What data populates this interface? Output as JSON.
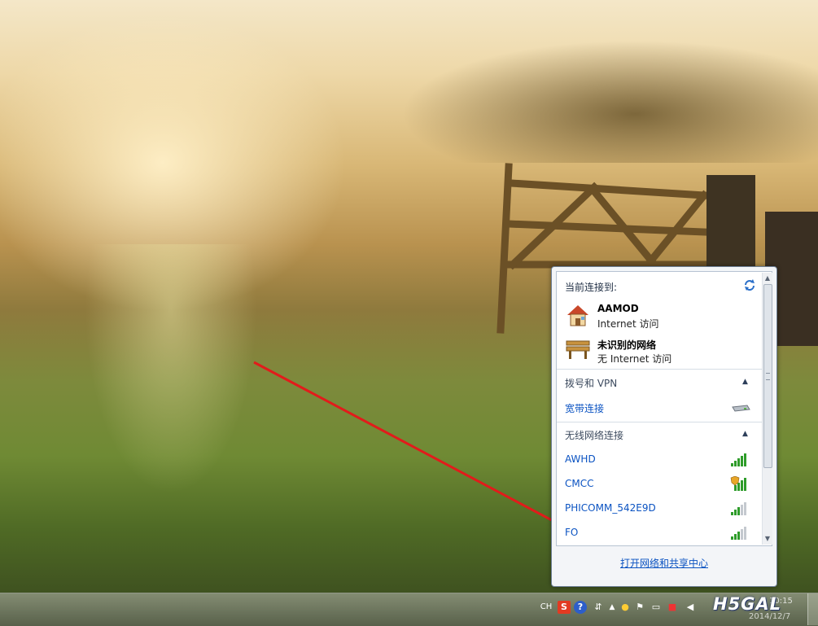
{
  "popup": {
    "header": "当前连接到:",
    "connections": [
      {
        "name": "AAMOD",
        "status": "Internet 访问",
        "icon": "home-network-icon"
      },
      {
        "name": "未识别的网络",
        "status": "无 Internet 访问",
        "icon": "public-network-bench-icon"
      }
    ],
    "dialup_section": {
      "label": "拨号和 VPN",
      "items": [
        {
          "name": "宽带连接",
          "icon": "modem-icon"
        }
      ]
    },
    "wireless_section": {
      "label": "无线网络连接",
      "networks": [
        {
          "ssid": "AWHD",
          "secured": false
        },
        {
          "ssid": "CMCC",
          "secured": true
        },
        {
          "ssid": "PHICOMM_542E9D",
          "secured": false
        },
        {
          "ssid": "FO",
          "secured": false
        }
      ]
    },
    "footer_link": "打开网络和共享中心"
  },
  "taskbar": {
    "language": "CH",
    "time": "10:15",
    "date": "2014/12/7"
  },
  "watermark": "H5GAL",
  "colors": {
    "link": "#0b53c2",
    "signal": "#2e9c2a",
    "arrow": "#e21b1b"
  }
}
